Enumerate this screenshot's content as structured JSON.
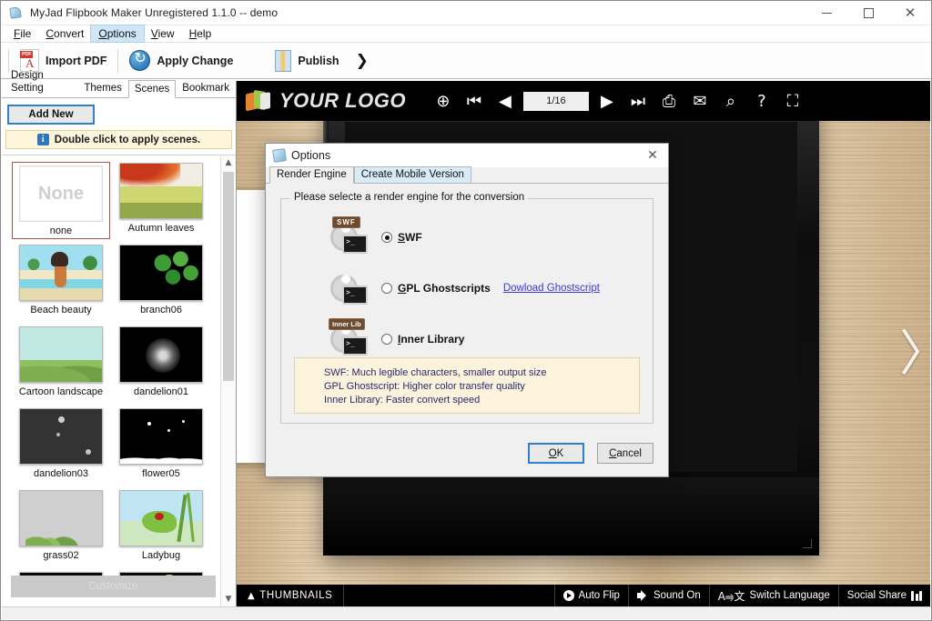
{
  "window": {
    "title": "MyJad Flipbook Maker Unregistered 1.1.0  -- demo",
    "minimize": "–",
    "maximize": "□",
    "close": "✕"
  },
  "menubar": [
    {
      "label": "File",
      "accel": "F"
    },
    {
      "label": "Convert",
      "accel": "C"
    },
    {
      "label": "Options",
      "accel": "O"
    },
    {
      "label": "View",
      "accel": "V"
    },
    {
      "label": "Help",
      "accel": "H"
    }
  ],
  "toolbar": {
    "import_pdf": "Import PDF",
    "apply_change": "Apply Change",
    "publish": "Publish",
    "overflow": "❯"
  },
  "left_panel": {
    "tabs": [
      {
        "label": "Design Setting",
        "selected": false
      },
      {
        "label": "Themes",
        "selected": false
      },
      {
        "label": "Scenes",
        "selected": true
      },
      {
        "label": "Bookmark",
        "selected": false
      }
    ],
    "add_new": "Add New",
    "hint": "Double click to apply scenes.",
    "customize": "Customize",
    "scenes": [
      {
        "name": "none",
        "selected": true,
        "kind": "none"
      },
      {
        "name": "Autumn leaves",
        "selected": false,
        "kind": "autumn"
      },
      {
        "name": "Beach beauty",
        "selected": false,
        "kind": "beach"
      },
      {
        "name": "branch06",
        "selected": false,
        "kind": "branch"
      },
      {
        "name": "Cartoon landscape",
        "selected": false,
        "kind": "landscape"
      },
      {
        "name": "dandelion01",
        "selected": false,
        "kind": "dandelion1"
      },
      {
        "name": "dandelion03",
        "selected": false,
        "kind": "dandelion3"
      },
      {
        "name": "flower05",
        "selected": false,
        "kind": "flower"
      },
      {
        "name": "grass02",
        "selected": false,
        "kind": "grass"
      },
      {
        "name": "Ladybug",
        "selected": false,
        "kind": "ladybug"
      },
      {
        "name": "",
        "selected": false,
        "kind": "partial1"
      },
      {
        "name": "",
        "selected": false,
        "kind": "partial2"
      }
    ]
  },
  "flipbook": {
    "logo_text": "YOUR LOGO",
    "page_indicator": "1/16",
    "top_icons": [
      {
        "name": "zoom-in-icon",
        "glyph": "⊕"
      },
      {
        "name": "first-page-icon",
        "glyph": "⏮"
      },
      {
        "name": "prev-page-icon",
        "glyph": "◀"
      },
      {
        "name": "next-page-icon",
        "glyph": "▶"
      },
      {
        "name": "last-page-icon",
        "glyph": "⏭"
      },
      {
        "name": "print-icon",
        "glyph": "⎙"
      },
      {
        "name": "email-icon",
        "glyph": "✉"
      },
      {
        "name": "search-icon",
        "glyph": "⌕"
      },
      {
        "name": "help-icon",
        "glyph": "?"
      },
      {
        "name": "fullscreen-icon",
        "glyph": "⛶"
      }
    ],
    "thumbnails": "THUMBNAILS",
    "auto_flip": "Auto Flip",
    "sound": "Sound On",
    "switch_language": "Switch Language",
    "social_share": "Social Share",
    "lang_icon": "A⥤文",
    "flip_prev": "〈",
    "flip_next": "〉"
  },
  "dialog": {
    "title": "Options",
    "close": "✕",
    "tabs": [
      {
        "label": "Render Engine",
        "selected": true
      },
      {
        "label": "Create Mobile Version",
        "selected": false
      }
    ],
    "group_legend": "Please selecte a render engine for the conversion",
    "options": [
      {
        "label": "SWF",
        "accel": "S",
        "badge": "SWF",
        "selected": true,
        "link": ""
      },
      {
        "label": "GPL Ghostscripts",
        "accel": "G",
        "badge": "",
        "selected": false,
        "link": "Dowload Ghostscript"
      },
      {
        "label": "Inner Library",
        "accel": "I",
        "badge": "Inner Lib",
        "selected": false,
        "link": ""
      }
    ],
    "info_lines": [
      "SWF: Much legible characters, smaller output size",
      "GPL Ghostscript: Higher color transfer quality",
      "Inner Library: Faster convert speed"
    ],
    "ok": "OK",
    "cancel": "Cancel",
    "console_prompt": ">_"
  },
  "colors": {
    "accent_blue": "#2f7fd0",
    "link_blue": "#3a3ad0",
    "info_bg": "#fbf3dc",
    "hint_bg": "#fdf6dd",
    "selected_scene_border": "#b5524a",
    "badge_brown": "#6e4a2f",
    "wood": "#d2b994"
  }
}
